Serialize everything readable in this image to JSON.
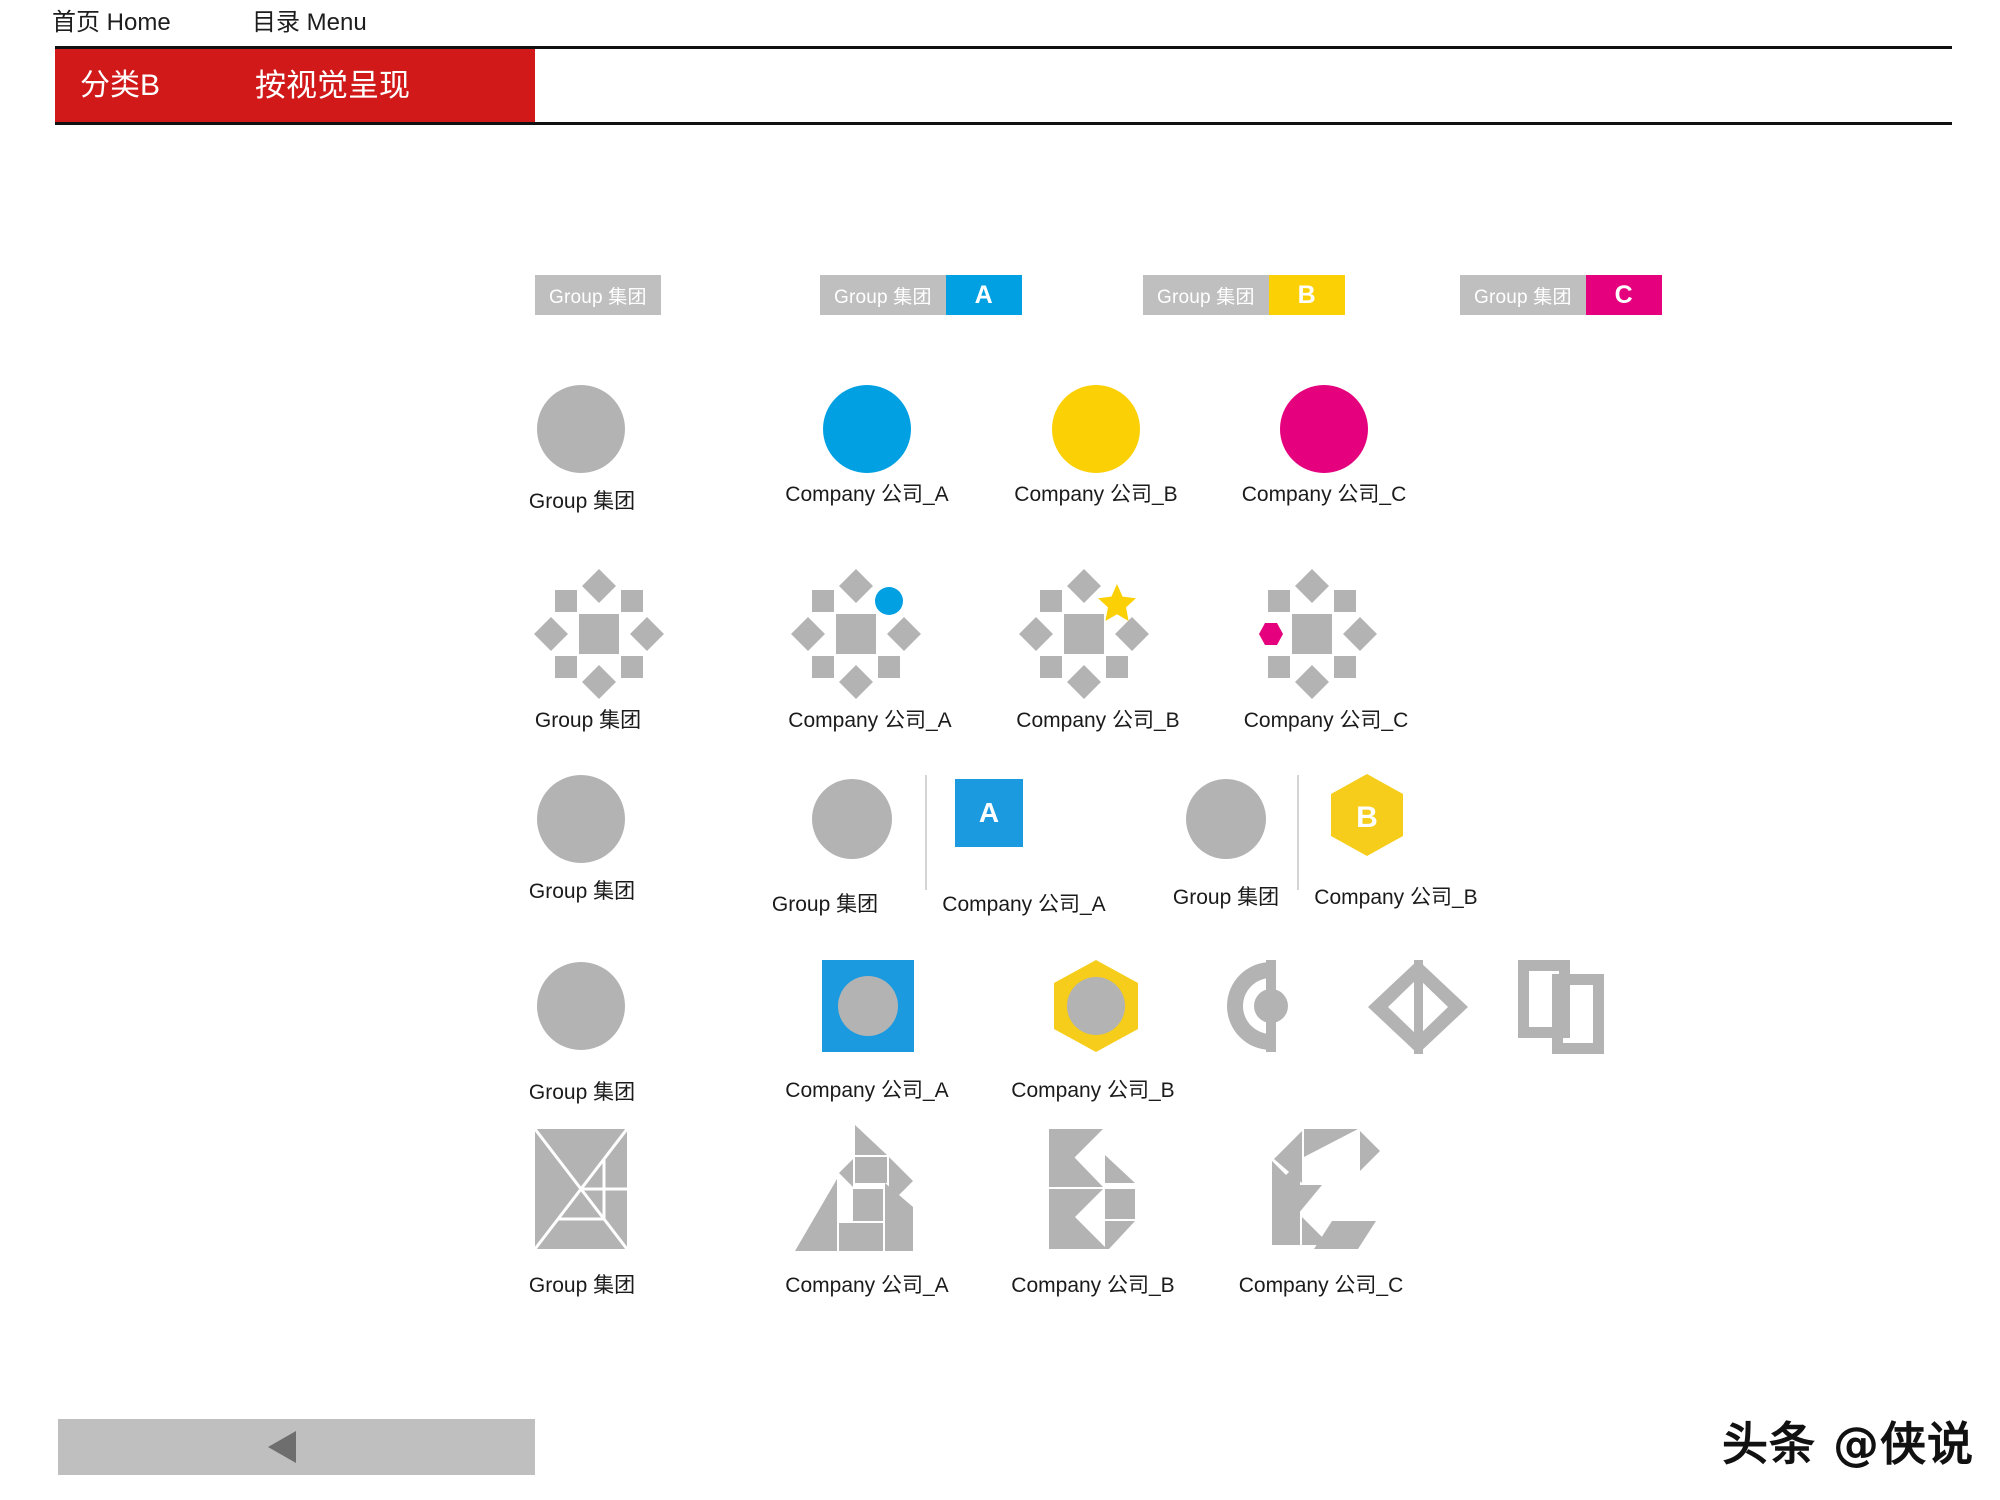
{
  "nav": {
    "home": "首页 Home",
    "menu": "目录 Menu"
  },
  "header": {
    "category": "分类B",
    "title": "按视觉呈现"
  },
  "colors": {
    "brand_red": "#d11919",
    "grey": "#bfbfbf",
    "grey_shape": "#b3b3b3",
    "blue": "#00a0e2",
    "yellow": "#fbd004",
    "magenta": "#e5007d",
    "badge_blue": "#1b9ae0",
    "badge_yellow": "#f5cd1a",
    "divider": "#d5d5d5",
    "text": "#1b1b1b"
  },
  "badges": [
    {
      "group_label": "Group 集团",
      "chip": "",
      "chip_color": ""
    },
    {
      "group_label": "Group 集团",
      "chip": "A",
      "chip_color": "#00a0e2"
    },
    {
      "group_label": "Group 集团",
      "chip": "B",
      "chip_color": "#fbd004"
    },
    {
      "group_label": "Group 集团",
      "chip": "C",
      "chip_color": "#e5007d"
    }
  ],
  "rows": {
    "row1": {
      "name": "solid-circles",
      "items": [
        {
          "caption": "Group 集团",
          "color": "#b3b3b3"
        },
        {
          "caption": "Company 公司_A",
          "color": "#00a0e2"
        },
        {
          "caption": "Company 公司_B",
          "color": "#fbd004"
        },
        {
          "caption": "Company 公司_C",
          "color": "#e5007d"
        }
      ]
    },
    "row2": {
      "name": "diamond-cluster",
      "items": [
        {
          "caption": "Group 集团",
          "accent": "none",
          "accent_color": "#b3b3b3"
        },
        {
          "caption": "Company 公司_A",
          "accent": "circle",
          "accent_color": "#00a0e2"
        },
        {
          "caption": "Company 公司_B",
          "accent": "star",
          "accent_color": "#fbd004"
        },
        {
          "caption": "Company 公司_C",
          "accent": "hexagon",
          "accent_color": "#e5007d"
        }
      ]
    },
    "row3": {
      "name": "circle-plus-letter",
      "items": [
        {
          "group_caption": "Group 集团",
          "company_caption": "",
          "letter": "",
          "shape": "none",
          "color": ""
        },
        {
          "group_caption": "Group 集团",
          "company_caption": "Company 公司_A",
          "letter": "A",
          "shape": "square",
          "color": "#1b9ae0"
        },
        {
          "group_caption": "Group 集团",
          "company_caption": "Company 公司_B",
          "letter": "B",
          "shape": "hexagon",
          "color": "#f5cd1a"
        }
      ]
    },
    "row4": {
      "name": "circle-in-frame",
      "items": [
        {
          "caption": "Group 集团",
          "shape": "circle",
          "color": "#b3b3b3"
        },
        {
          "caption": "Company 公司_A",
          "shape": "square-circle",
          "color": "#1b9ae0"
        },
        {
          "caption": "Company 公司_B",
          "shape": "hexagon-circle",
          "color": "#f5cd1a"
        },
        {
          "caption": "",
          "shape": "ring-bar",
          "color": "#b3b3b3"
        },
        {
          "caption": "",
          "shape": "diamond-bar",
          "color": "#b3b3b3"
        },
        {
          "caption": "",
          "shape": "double-frame",
          "color": "#b3b3b3"
        }
      ]
    },
    "row5": {
      "name": "tangram-letters",
      "items": [
        {
          "caption": "Group 集团",
          "glyph": "square"
        },
        {
          "caption": "Company 公司_A",
          "glyph": "A"
        },
        {
          "caption": "Company 公司_B",
          "glyph": "B"
        },
        {
          "caption": "Company 公司_C",
          "glyph": "C"
        }
      ]
    }
  },
  "footer": {
    "back_button": "◀",
    "watermark": "头条 @侠说"
  }
}
